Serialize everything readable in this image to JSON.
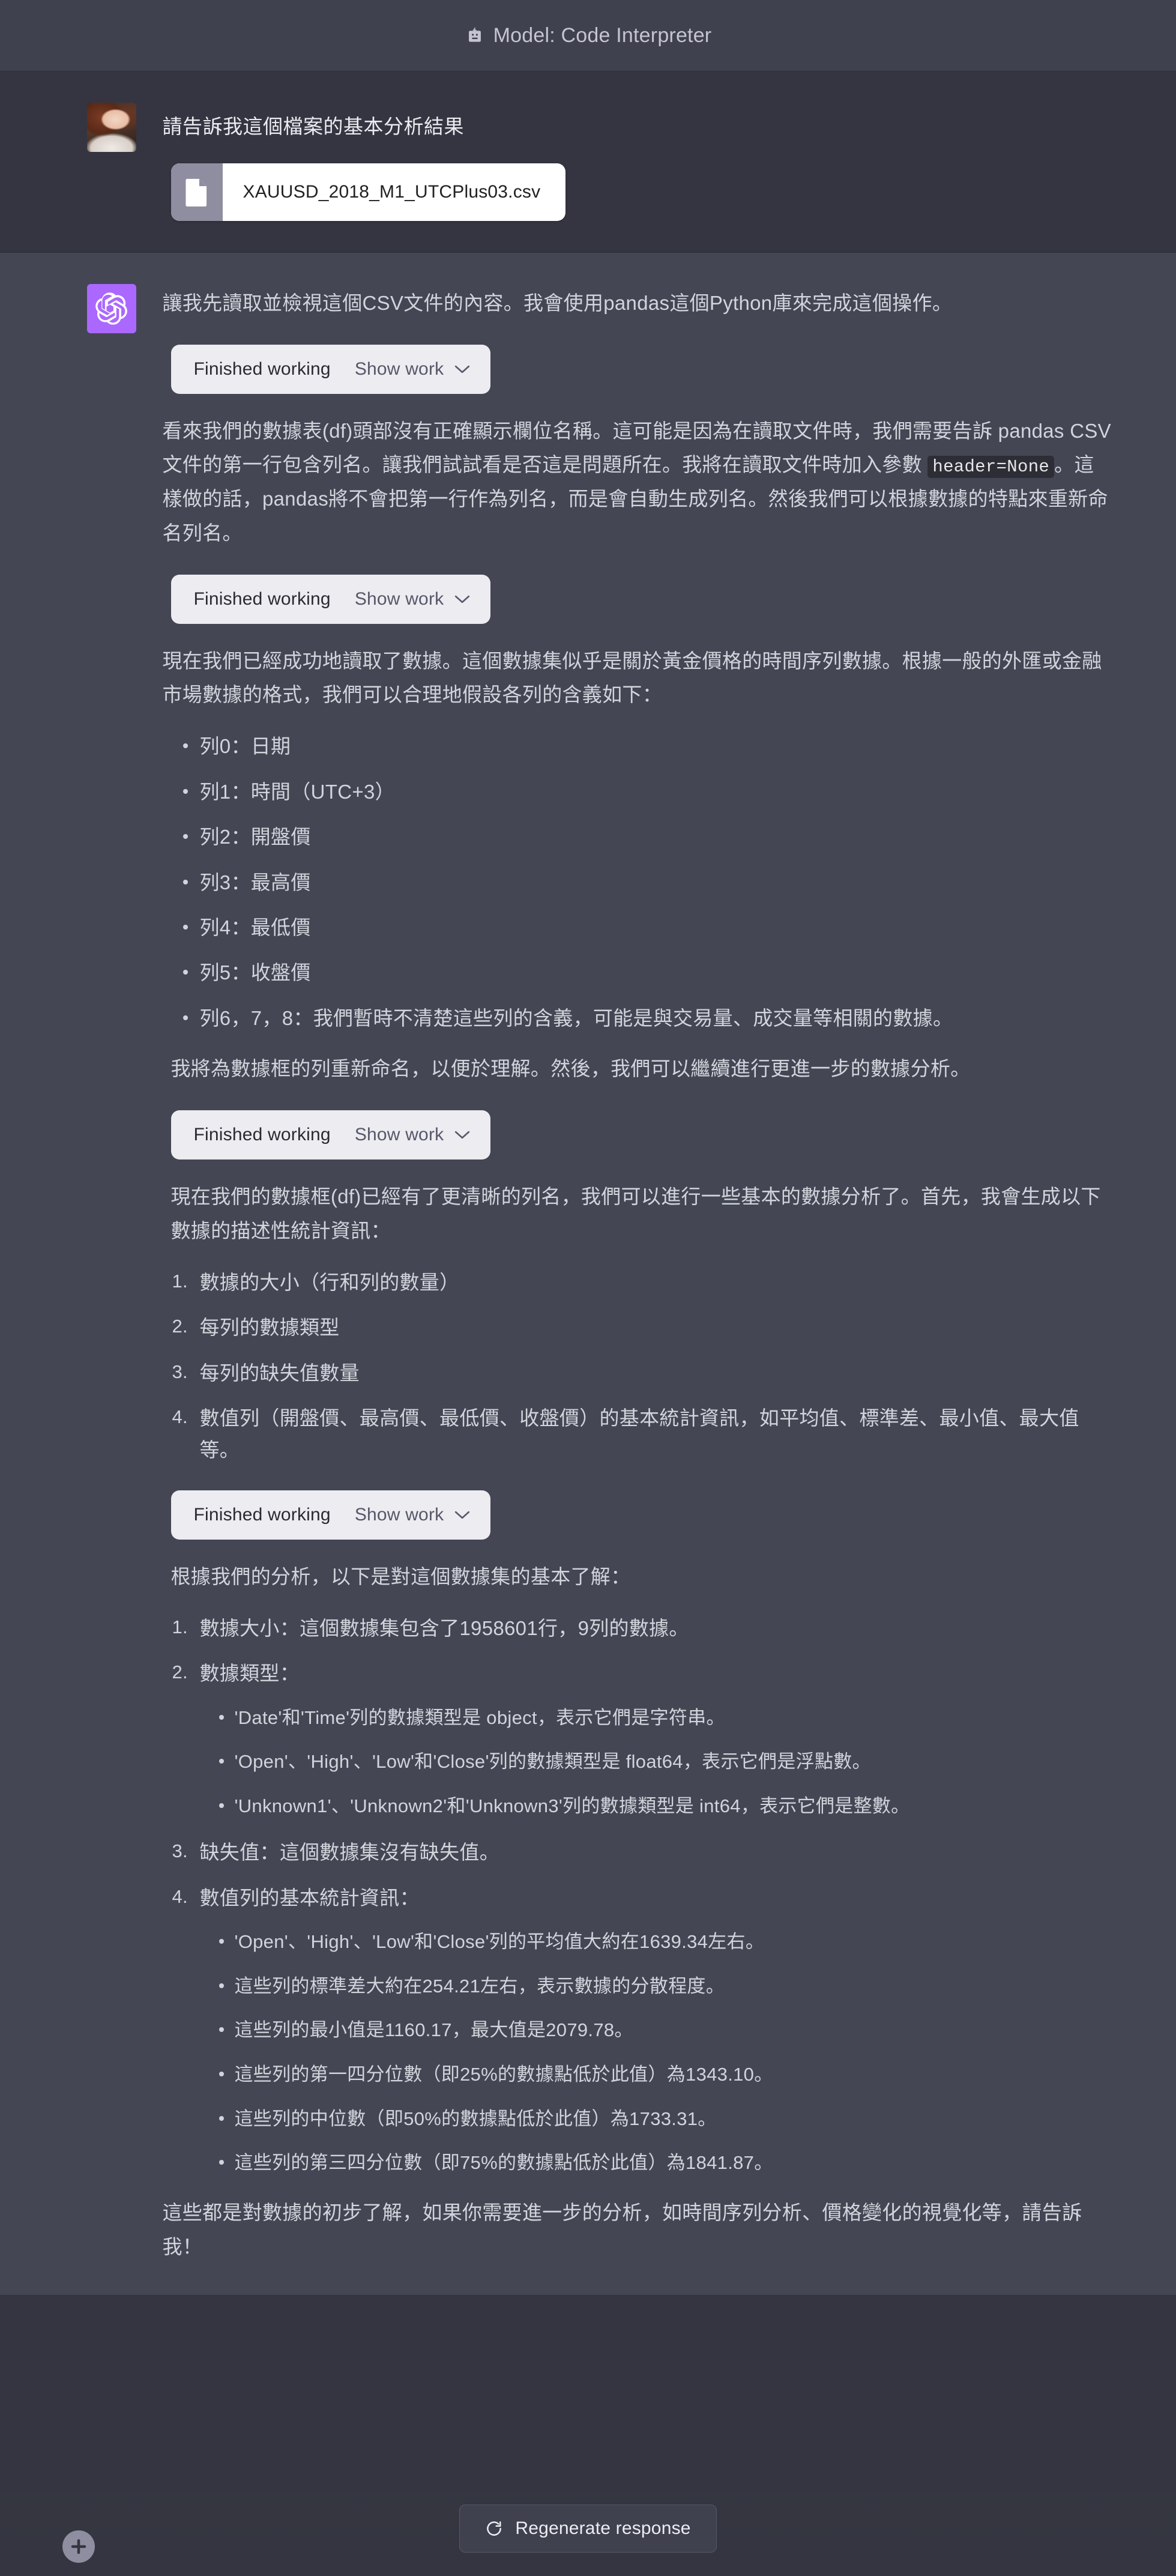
{
  "header": {
    "title": "Model: Code Interpreter",
    "icon": "code-interpreter-icon"
  },
  "conversation": {
    "user_message": {
      "text": "請告訴我這個檔案的基本分析結果",
      "attachment": {
        "filename": "XAUUSD_2018_M1_UTCPlus03.csv",
        "icon": "file-icon"
      }
    },
    "assistant_message": {
      "intro": "讓我先讀取並檢視這個CSV文件的內容。我會使用pandas這個Python庫來完成這個操作。",
      "work_blocks": [
        {
          "status": "Finished working",
          "toggle": "Show work"
        },
        {
          "status": "Finished working",
          "toggle": "Show work"
        },
        {
          "status": "Finished working",
          "toggle": "Show work"
        },
        {
          "status": "Finished working",
          "toggle": "Show work"
        }
      ],
      "para_header_none_a": "看來我們的數據表(df)頭部沒有正確顯示欄位名稱。這可能是因為在讀取文件時，我們需要告訴 pandas CSV 文件的第一行包含列名。讓我們試試看是否這是問題所在。我將在讀取文件時加入參數 ",
      "para_header_none_code": "header=None",
      "para_header_none_b": "。這樣做的話，pandas將不會把第一行作為列名，而是會自動生成列名。然後我們可以根據數據的特點來重新命名列名。",
      "para_columns_intro": "現在我們已經成功地讀取了數據。這個數據集似乎是關於黃金價格的時間序列數據。根據一般的外匯或金融市場數據的格式，我們可以合理地假設各列的含義如下：",
      "column_bullets": [
        "列0：日期",
        "列1：時間（UTC+3）",
        "列2：開盤價",
        "列3：最高價",
        "列4：最低價",
        "列5：收盤價",
        "列6，7，8：我們暫時不清楚這些列的含義，可能是與交易量、成交量等相關的數據。"
      ],
      "para_rename": "我將為數據框的列重新命名，以便於理解。然後，我們可以繼續進行更進一步的數據分析。",
      "para_stats_intro": "現在我們的數據框(df)已經有了更清晰的列名，我們可以進行一些基本的數據分析了。首先，我會生成以下數據的描述性統計資訊：",
      "stats_plan_items": [
        "數據的大小（行和列的數量）",
        "每列的數據類型",
        "每列的缺失值數量",
        "數值列（開盤價、最高價、最低價、收盤價）的基本統計資訊，如平均值、標準差、最小值、最大值等。"
      ],
      "para_results_intro": "根據我們的分析，以下是對這個數據集的基本了解：",
      "results": [
        {
          "label": "數據大小：這個數據集包含了1958601行，9列的數據。",
          "sub": []
        },
        {
          "label": "數據類型：",
          "sub": [
            "'Date'和'Time'列的數據類型是 object，表示它們是字符串。",
            "'Open'、'High'、'Low'和'Close'列的數據類型是 float64，表示它們是浮點數。",
            "'Unknown1'、'Unknown2'和'Unknown3'列的數據類型是 int64，表示它們是整數。"
          ]
        },
        {
          "label": "缺失值：這個數據集沒有缺失值。",
          "sub": []
        },
        {
          "label": "數值列的基本統計資訊：",
          "sub": [
            "'Open'、'High'、'Low'和'Close'列的平均值大約在1639.34左右。",
            "這些列的標準差大約在254.21左右，表示數據的分散程度。",
            "這些列的最小值是1160.17，最大值是2079.78。",
            "這些列的第一四分位數（即25%的數據點低於此值）為1343.10。",
            "這些列的中位數（即50%的數據點低於此值）為1733.31。",
            "這些列的第三四分位數（即75%的數據點低於此值）為1841.87。"
          ]
        }
      ],
      "para_closing": "這些都是對數據的初步了解，如果你需要進一步的分析，如時間序列分析、價格變化的視覺化等，請告訴我！"
    }
  },
  "footer": {
    "regenerate_label": "Regenerate response",
    "regenerate_icon": "refresh-icon",
    "add_button_icon": "plus-icon"
  },
  "colors": {
    "page_bg": "#343541",
    "assistant_bg": "#444654",
    "header_bg": "#40414f",
    "accent_purple": "#ab68ff",
    "text": "#d1d5db",
    "chip_bg": "#ececf1"
  }
}
